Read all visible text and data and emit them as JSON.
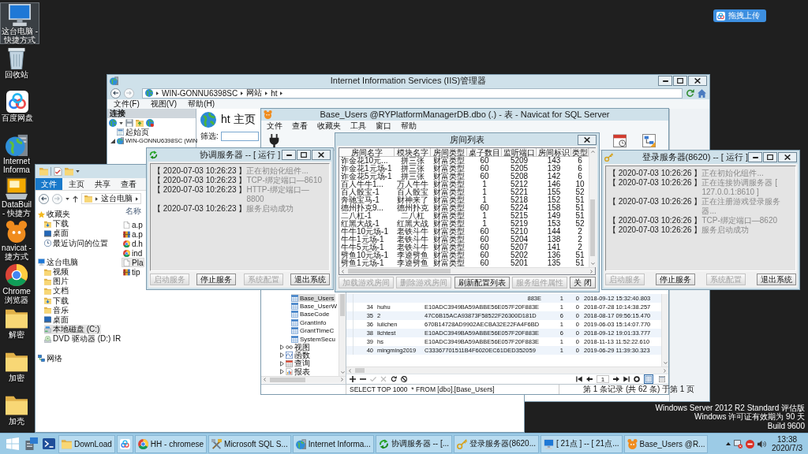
{
  "desktop_icons": [
    {
      "label": [
        "这台电脑 -",
        "快捷方式"
      ],
      "kind": "computer",
      "selected": true
    },
    {
      "label": [
        "回收站"
      ],
      "kind": "recycle",
      "selected": false
    },
    {
      "label": [
        "百度网盘"
      ],
      "kind": "cloud",
      "selected": false
    },
    {
      "label": [
        "Internet",
        "Informa"
      ],
      "kind": "iis",
      "selected": false
    },
    {
      "label": [
        "DataBuil",
        "- 快捷方"
      ],
      "kind": "databuilder",
      "selected": false
    },
    {
      "label": [
        "navicat -",
        "捷方式"
      ],
      "kind": "navicat",
      "selected": false
    },
    {
      "label": [
        "Chrome",
        "浏览器"
      ],
      "kind": "chrome",
      "selected": false
    },
    {
      "label": [
        "解密"
      ],
      "kind": "folder",
      "selected": false
    },
    {
      "label": [
        "加密"
      ],
      "kind": "folder",
      "selected": false
    },
    {
      "label": [
        "加壳"
      ],
      "kind": "folder",
      "selected": false
    }
  ],
  "upload_button": {
    "label": "拖拽上传"
  },
  "iis_window": {
    "title": "Internet Information Services (IIS)管理器",
    "nav_buttons": [
      {
        "kind": "back",
        "disabled": false
      },
      {
        "kind": "forward",
        "disabled": true
      }
    ],
    "address": [
      "WIN-GONNU6398SC",
      "网站",
      "ht"
    ],
    "menu": [
      "文件(F)",
      "视图(V)",
      "帮助(H)"
    ],
    "connections_header": "连接",
    "tree": [
      {
        "label": "起始页",
        "kind": "page"
      },
      {
        "label": "WIN-GONNU6398SC (WIN",
        "kind": "server",
        "expanded": true
      }
    ],
    "page_title": "ht 主页",
    "filter_label": "筛选:"
  },
  "explorer_window": {
    "ribbon_tabs": [
      {
        "label": "文件",
        "kind": "menu",
        "selected": false
      },
      {
        "label": "主页",
        "kind": "tab",
        "selected": false
      },
      {
        "label": "共享",
        "kind": "tab",
        "selected": false
      },
      {
        "label": "查看",
        "kind": "tab",
        "selected": false
      }
    ],
    "nav_buttons": [
      {
        "kind": "back",
        "disabled": false
      },
      {
        "kind": "forward",
        "disabled": true
      }
    ],
    "address": [
      "这台电脑"
    ],
    "nav": [
      {
        "label": "收藏夹",
        "kind": "favorites",
        "selected": false,
        "children": [
          {
            "label": "下载",
            "kind": "downloads",
            "selected": false
          },
          {
            "label": "桌面",
            "kind": "desktop",
            "selected": false
          },
          {
            "label": "最近访问的位置",
            "kind": "recent",
            "selected": false
          }
        ]
      },
      {
        "label": "这台电脑",
        "kind": "computer",
        "selected": false,
        "children": [
          {
            "label": "视频",
            "kind": "videos",
            "selected": false
          },
          {
            "label": "图片",
            "kind": "pictures",
            "selected": false
          },
          {
            "label": "文档",
            "kind": "documents",
            "selected": false
          },
          {
            "label": "下载",
            "kind": "downloads",
            "selected": false
          },
          {
            "label": "音乐",
            "kind": "music",
            "selected": false
          },
          {
            "label": "桌面",
            "kind": "desktop",
            "selected": false
          },
          {
            "label": "本地磁盘 (C:)",
            "kind": "drive",
            "selected": true
          },
          {
            "label": "DVD 驱动器 (D:) IR",
            "kind": "dvd",
            "selected": false
          }
        ]
      },
      {
        "label": "网络",
        "kind": "network",
        "selected": false
      }
    ],
    "column_header": "名称",
    "files": [
      {
        "name": "a.p",
        "kind": "document",
        "selected": false
      },
      {
        "name": "a.p",
        "kind": "archive",
        "selected": false
      },
      {
        "name": "d.h",
        "kind": "chrome",
        "selected": false
      },
      {
        "name": "ind",
        "kind": "chrome",
        "selected": false
      },
      {
        "name": "Pla",
        "kind": "document",
        "selected": true
      },
      {
        "name": "tip",
        "kind": "archive",
        "selected": false
      }
    ]
  },
  "navicat_window": {
    "title": "Base_Users @RYPlatformManagerDB.dbo (.) - 表 - Navicat for SQL Server",
    "menu": [
      "文件",
      "查看",
      "收藏夹",
      "工具",
      "窗口",
      "帮助"
    ],
    "tree": [
      {
        "kind": "group",
        "children": [
          {
            "label": "Base_Users",
            "kind": "table",
            "selected": true
          },
          {
            "label": "Base_UserW",
            "kind": "table",
            "selected": false
          },
          {
            "label": "BaseCode",
            "kind": "table",
            "selected": false
          },
          {
            "label": "GrantInfo",
            "kind": "table",
            "selected": false
          },
          {
            "label": "GrantTimeC",
            "kind": "table",
            "selected": false
          },
          {
            "label": "SystemSecu",
            "kind": "table",
            "selected": false
          }
        ]
      },
      {
        "label": "视图",
        "kind": "views",
        "expanded": false,
        "selected": false
      },
      {
        "label": "函数",
        "kind": "functions",
        "expanded": false,
        "selected": false
      },
      {
        "label": "查询",
        "kind": "queries",
        "expanded": false,
        "selected": false
      },
      {
        "label": "报表",
        "kind": "reports",
        "expanded": false,
        "selected": false
      }
    ],
    "rows": [
      {
        "column_3": "883E",
        "column_4": "1",
        "column_5": "0",
        "column_6": "2018-09-12 15:32:40.803"
      },
      {
        "column_1": "34",
        "column_2": "huhu",
        "column_3": "E10ADC3949BA59ABBE56E057F20F883E",
        "column_4": "1",
        "column_5": "0",
        "column_6": "2018-07-28 10:14:38.257"
      },
      {
        "column_1": "35",
        "column_2": "2",
        "column_3": "47C6B15ACA93873F58522F26300D181D",
        "column_4": "6",
        "column_5": "0",
        "column_6": "2018-08-17 09:56:15.470"
      },
      {
        "column_1": "36",
        "column_2": "lulichen",
        "column_3": "670B14728AD9902AECBA32E22FA4F6BD",
        "column_4": "1",
        "column_5": "0",
        "column_6": "2019-06-03 15:14:07.770"
      },
      {
        "column_1": "38",
        "column_2": "llchtest",
        "column_3": "E10ADC3949BA59ABBE56E057F20F883E",
        "column_4": "6",
        "column_5": "0",
        "column_6": "2018-09-12 19:01:33.777"
      },
      {
        "column_1": "39",
        "column_2": "hs",
        "column_3": "E10ADC3949BA59ABBE56E057F20F883E",
        "column_4": "1",
        "column_5": "0",
        "column_6": "2018-11-13 11:52:22.610"
      },
      {
        "column_1": "40",
        "column_2": "mingming2019",
        "column_3": "C33367701511B4F6020EC61DED352059",
        "column_4": "1",
        "column_5": "0",
        "column_6": "2019-06-29 11:39:30.323"
      }
    ],
    "edit_tools": [
      {
        "kind": "add",
        "disabled": false
      },
      {
        "kind": "delete",
        "disabled": false
      },
      {
        "kind": "apply",
        "disabled": true
      },
      {
        "kind": "discard",
        "disabled": true
      },
      {
        "kind": "refresh",
        "disabled": false
      },
      {
        "kind": "stop",
        "disabled": false
      }
    ],
    "pager": {
      "page": "1"
    },
    "views": [
      {
        "kind": "grid",
        "selected": true
      },
      {
        "kind": "form",
        "selected": false
      }
    ],
    "sql": "SELECT TOP 1000  * FROM [dbo].[Base_Users]",
    "record_info": "第 1 条记录 (共 62 条) 于第 1 页"
  },
  "coordinator_window": {
    "title": "协调服务器 -- [ 运行 ]",
    "log": [
      {
        "time": "【 2020-07-03 10:26:23 】",
        "message": "正在初始化组件..."
      },
      {
        "time": "【 2020-07-03 10:26:23 】",
        "message": "TCP-绑定端口—8610"
      },
      {
        "time": "【 2020-07-03 10:26:23 】",
        "message": "HTTP-绑定端口—8800"
      },
      {
        "time": "【 2020-07-03 10:26:23 】",
        "message": "服务启动成功"
      }
    ],
    "buttons": [
      {
        "label": "启动服务",
        "disabled": true
      },
      {
        "label": "停止服务",
        "disabled": false
      },
      {
        "label": "系统配置",
        "disabled": true
      },
      {
        "label": "退出系统",
        "disabled": false
      }
    ]
  },
  "room_list_window": {
    "title": "房间列表",
    "columns": [
      "房间名字",
      "模块名字",
      "房间类型",
      "桌子数目",
      "监听端口",
      "房间标识",
      "类型"
    ],
    "rows": [
      [
        "诈金花10元...",
        "拼三张",
        "财富类型",
        "60",
        "5209",
        "143",
        "6"
      ],
      [
        "诈金花1元场-1",
        "拼三张",
        "财富类型",
        "60",
        "5205",
        "139",
        "6"
      ],
      [
        "诈金花5元场-1",
        "拼三张",
        "财富类型",
        "60",
        "5208",
        "142",
        "6"
      ],
      [
        "百人牛牛1...",
        "万人牛牛",
        "财富类型",
        "1",
        "5212",
        "146",
        "10"
      ],
      [
        "百人骰宝-1",
        "百人骰宝",
        "财富类型",
        "1",
        "5221",
        "155",
        "52"
      ],
      [
        "奔驰宝马-1",
        "财神来了",
        "财富类型",
        "1",
        "5218",
        "152",
        "51"
      ],
      [
        "德州扑克9...",
        "德州扑克",
        "财富类型",
        "60",
        "5224",
        "158",
        "51"
      ],
      [
        "二八杠-1",
        "二八杠",
        "财富类型",
        "1",
        "5215",
        "149",
        "51"
      ],
      [
        "红黑大战-1",
        "红黑大战",
        "财富类型",
        "1",
        "5219",
        "153",
        "52"
      ],
      [
        "牛牛10元场-1",
        "老铁斗牛",
        "财富类型",
        "60",
        "5210",
        "144",
        "2"
      ],
      [
        "牛牛1元场-1",
        "老铁斗牛",
        "财富类型",
        "60",
        "5204",
        "138",
        "2"
      ],
      [
        "牛牛5元场-1",
        "老铁斗牛",
        "财富类型",
        "60",
        "5207",
        "141",
        "2"
      ],
      [
        "劈鱼10元场-1",
        "李逵劈鱼",
        "财富类型",
        "60",
        "5202",
        "136",
        "51"
      ],
      [
        "劈鱼1元场-1",
        "李逵劈鱼",
        "财富类型",
        "60",
        "5201",
        "135",
        "51"
      ]
    ],
    "buttons": [
      {
        "label": "加载游戏房间",
        "disabled": true
      },
      {
        "label": "删除游戏房间",
        "disabled": true
      },
      {
        "label": "刷新配置列表",
        "disabled": false
      },
      {
        "label": "服务组件属性",
        "disabled": true
      },
      {
        "label": "关 闭",
        "disabled": false
      }
    ]
  },
  "login_server_window": {
    "title": "登录服务器(8620) -- [ 运行 ]",
    "log": [
      {
        "time": "【 2020-07-03 10:26:26 】",
        "message": "正在初始化组件..."
      },
      {
        "time": "【 2020-07-03 10:26:26 】",
        "message": "正在连接协调服务器 [ 127.0.0.1:8610 ]"
      },
      {
        "time": "【 2020-07-03 10:26:26 】",
        "message": "正在注册游戏登录服务器..."
      },
      {
        "time": "【 2020-07-03 10:26:26 】",
        "message": "TCP-绑定端口—8620"
      },
      {
        "time": "【 2020-07-03 10:26:26 】",
        "message": "服务启动成功"
      }
    ],
    "buttons": [
      {
        "label": "启动服务",
        "disabled": true
      },
      {
        "label": "停止服务",
        "disabled": false
      },
      {
        "label": "系统配置",
        "disabled": true
      },
      {
        "label": "退出系统",
        "disabled": false
      }
    ]
  },
  "os_notice": [
    "Windows Server 2012 R2 Standard 评估版",
    "Windows 许可证有效期为 90 天",
    "Build 9600"
  ],
  "taskbar": {
    "buttons": [
      {
        "label": "DownLoad",
        "kind": "folder"
      },
      {
        "kind": "cloud"
      },
      {
        "label": "HH - chromese",
        "kind": "chrome"
      },
      {
        "label": "Microsoft SQL S...",
        "kind": "sql"
      },
      {
        "label": "Internet Informa...",
        "kind": "iis"
      },
      {
        "label": "协调服务器 -- [...",
        "kind": "coordinator"
      },
      {
        "label": "登录服务器(8620...",
        "kind": "key"
      },
      {
        "label": "[ 21点 ] -- [ 21点...",
        "kind": "computer"
      },
      {
        "label": "Base_Users @R...",
        "kind": "navicat"
      }
    ],
    "time": "13:38",
    "date": "2020/7/3"
  }
}
